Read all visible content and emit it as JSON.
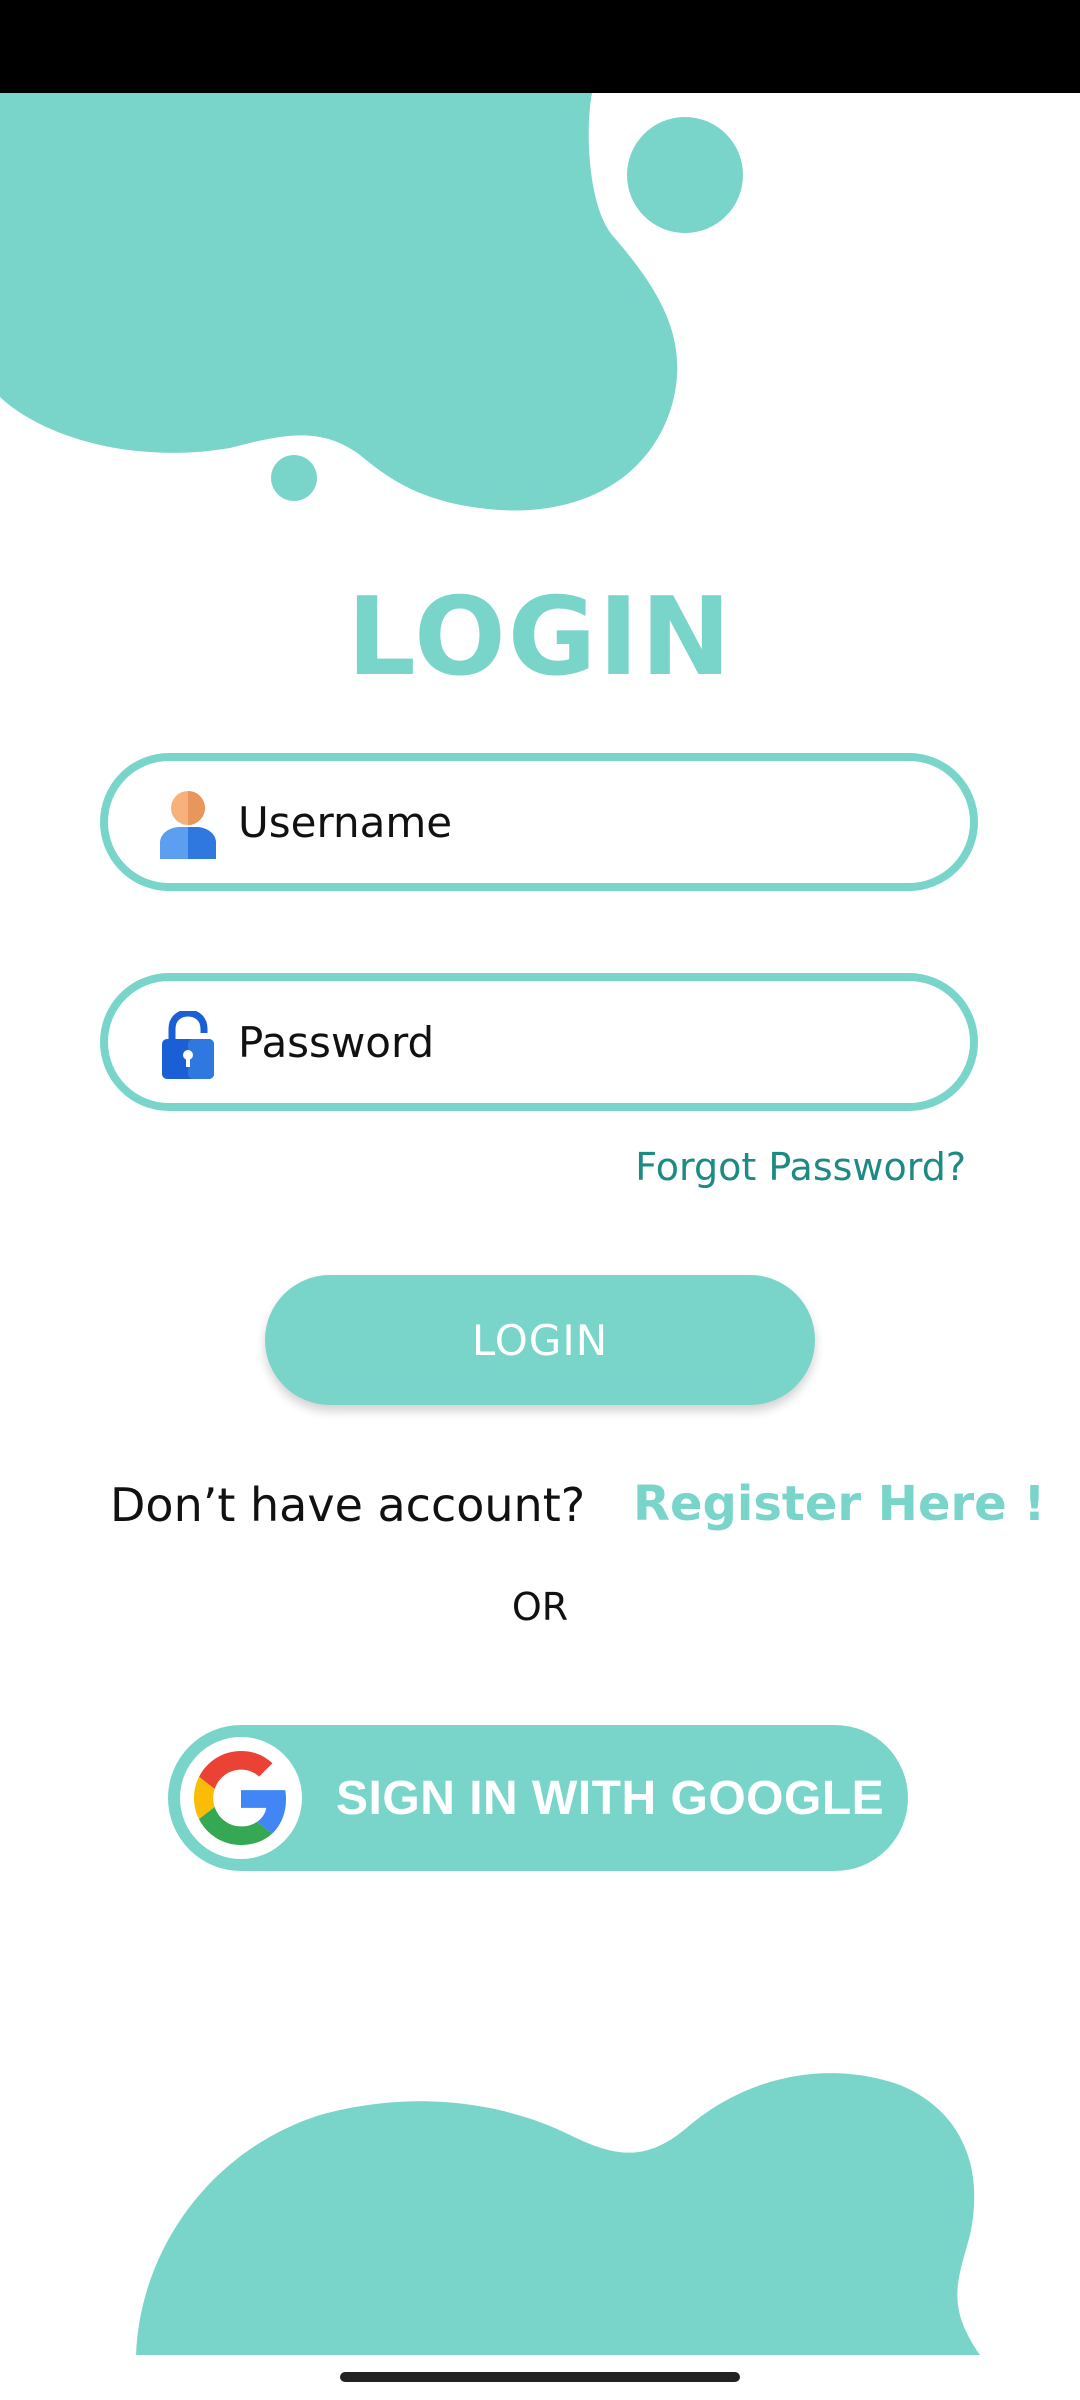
{
  "colors": {
    "accent": "#79d5ca",
    "link": "#1e8a84",
    "text": "#111111"
  },
  "page": {
    "title": "LOGIN"
  },
  "form": {
    "username": {
      "placeholder": "Username",
      "icon": "user-icon"
    },
    "password": {
      "placeholder": "Password",
      "icon": "lock-icon"
    },
    "forgot_label": "Forgot Password?",
    "login_label": "LOGIN"
  },
  "register": {
    "question": "Don’t have account?",
    "link": "Register Here !"
  },
  "divider": "OR",
  "google": {
    "label": "SIGN IN WITH GOOGLE",
    "icon": "google-icon"
  }
}
